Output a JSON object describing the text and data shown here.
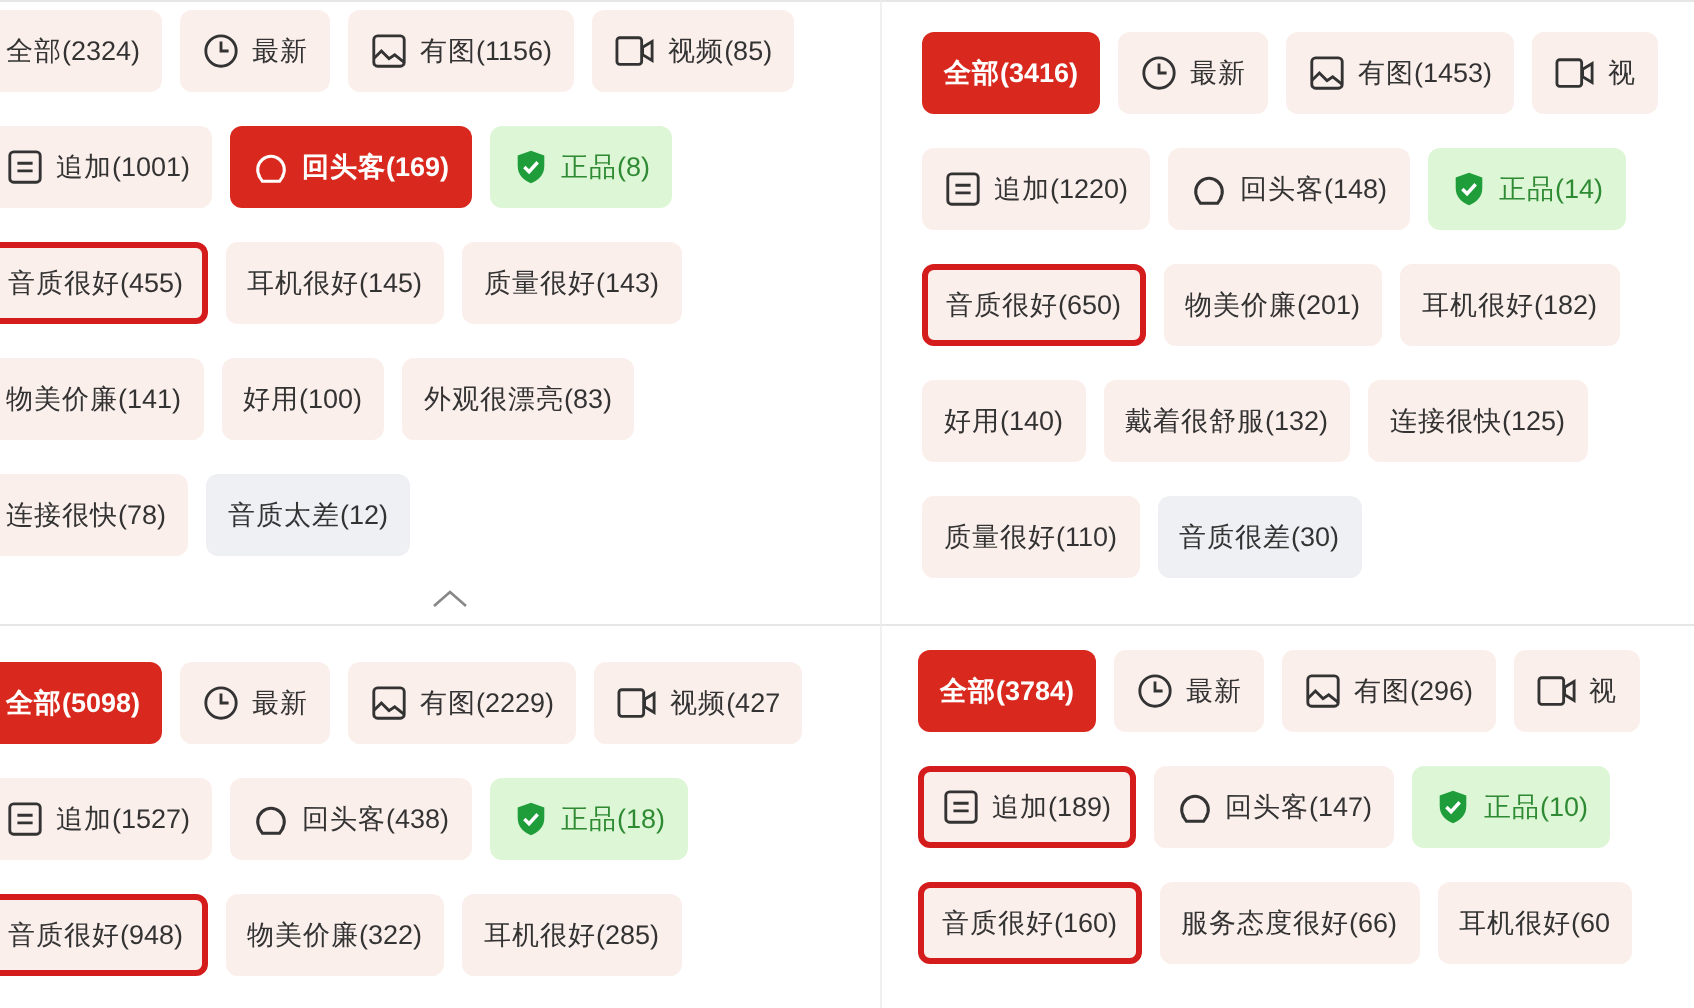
{
  "panels": [
    {
      "rows": [
        [
          {
            "kind": "all",
            "label": "全部(2324)",
            "selected": false,
            "marked": false
          },
          {
            "kind": "latest",
            "label": "最新",
            "selected": false,
            "marked": false
          },
          {
            "kind": "photos",
            "label": "有图(1156)",
            "selected": false,
            "marked": false
          },
          {
            "kind": "video",
            "label": "视频(85)",
            "selected": false,
            "marked": false
          }
        ],
        [
          {
            "kind": "followup",
            "label": "追加(1001)",
            "selected": false,
            "marked": false
          },
          {
            "kind": "repeat",
            "label": "回头客(169)",
            "selected": true,
            "marked": false
          },
          {
            "kind": "genuine",
            "label": "正品(8)",
            "selected": false,
            "marked": false
          }
        ],
        [
          {
            "kind": "tag",
            "label": "音质很好(455)",
            "selected": false,
            "marked": true
          },
          {
            "kind": "tag",
            "label": "耳机很好(145)",
            "selected": false,
            "marked": false
          },
          {
            "kind": "tag",
            "label": "质量很好(143)",
            "selected": false,
            "marked": false
          }
        ],
        [
          {
            "kind": "tag",
            "label": "物美价廉(141)",
            "selected": false,
            "marked": false
          },
          {
            "kind": "tag",
            "label": "好用(100)",
            "selected": false,
            "marked": false
          },
          {
            "kind": "tag",
            "label": "外观很漂亮(83)",
            "selected": false,
            "marked": false
          }
        ],
        [
          {
            "kind": "tag",
            "label": "连接很快(78)",
            "selected": false,
            "marked": false
          },
          {
            "kind": "negative",
            "label": "音质太差(12)",
            "selected": false,
            "marked": false
          }
        ]
      ],
      "collapse": true
    },
    {
      "rows": [
        [
          {
            "kind": "all",
            "label": "全部(3416)",
            "selected": true,
            "marked": false
          },
          {
            "kind": "latest",
            "label": "最新",
            "selected": false,
            "marked": false
          },
          {
            "kind": "photos",
            "label": "有图(1453)",
            "selected": false,
            "marked": false
          },
          {
            "kind": "video",
            "label": "视",
            "selected": false,
            "marked": false
          }
        ],
        [
          {
            "kind": "followup",
            "label": "追加(1220)",
            "selected": false,
            "marked": false
          },
          {
            "kind": "repeat",
            "label": "回头客(148)",
            "selected": false,
            "marked": false
          },
          {
            "kind": "genuine",
            "label": "正品(14)",
            "selected": false,
            "marked": false
          }
        ],
        [
          {
            "kind": "tag",
            "label": "音质很好(650)",
            "selected": false,
            "marked": true
          },
          {
            "kind": "tag",
            "label": "物美价廉(201)",
            "selected": false,
            "marked": false
          },
          {
            "kind": "tag",
            "label": "耳机很好(182)",
            "selected": false,
            "marked": false
          }
        ],
        [
          {
            "kind": "tag",
            "label": "好用(140)",
            "selected": false,
            "marked": false
          },
          {
            "kind": "tag",
            "label": "戴着很舒服(132)",
            "selected": false,
            "marked": false
          },
          {
            "kind": "tag",
            "label": "连接很快(125)",
            "selected": false,
            "marked": false
          }
        ],
        [
          {
            "kind": "tag",
            "label": "质量很好(110)",
            "selected": false,
            "marked": false
          },
          {
            "kind": "negative",
            "label": "音质很差(30)",
            "selected": false,
            "marked": false
          }
        ]
      ]
    },
    {
      "rows": [
        [
          {
            "kind": "all",
            "label": "全部(5098)",
            "selected": true,
            "marked": false
          },
          {
            "kind": "latest",
            "label": "最新",
            "selected": false,
            "marked": false
          },
          {
            "kind": "photos",
            "label": "有图(2229)",
            "selected": false,
            "marked": false
          },
          {
            "kind": "video",
            "label": "视频(427",
            "selected": false,
            "marked": false
          }
        ],
        [
          {
            "kind": "followup",
            "label": "追加(1527)",
            "selected": false,
            "marked": false
          },
          {
            "kind": "repeat",
            "label": "回头客(438)",
            "selected": false,
            "marked": false
          },
          {
            "kind": "genuine",
            "label": "正品(18)",
            "selected": false,
            "marked": false
          }
        ],
        [
          {
            "kind": "tag",
            "label": "音质很好(948)",
            "selected": false,
            "marked": true
          },
          {
            "kind": "tag",
            "label": "物美价廉(322)",
            "selected": false,
            "marked": false
          },
          {
            "kind": "tag",
            "label": "耳机很好(285)",
            "selected": false,
            "marked": false
          }
        ]
      ]
    },
    {
      "rows": [
        [
          {
            "kind": "all",
            "label": "全部(3784)",
            "selected": true,
            "marked": false
          },
          {
            "kind": "latest",
            "label": "最新",
            "selected": false,
            "marked": false
          },
          {
            "kind": "photos",
            "label": "有图(296)",
            "selected": false,
            "marked": false
          },
          {
            "kind": "video",
            "label": "视",
            "selected": false,
            "marked": false
          }
        ],
        [
          {
            "kind": "followup",
            "label": "追加(189)",
            "selected": false,
            "marked": true
          },
          {
            "kind": "repeat",
            "label": "回头客(147)",
            "selected": false,
            "marked": false
          },
          {
            "kind": "genuine",
            "label": "正品(10)",
            "selected": false,
            "marked": false
          }
        ],
        [
          {
            "kind": "tag",
            "label": "音质很好(160)",
            "selected": false,
            "marked": true
          },
          {
            "kind": "tag",
            "label": "服务态度很好(66)",
            "selected": false,
            "marked": false
          },
          {
            "kind": "tag",
            "label": "耳机很好(60",
            "selected": false,
            "marked": false
          }
        ]
      ]
    }
  ]
}
